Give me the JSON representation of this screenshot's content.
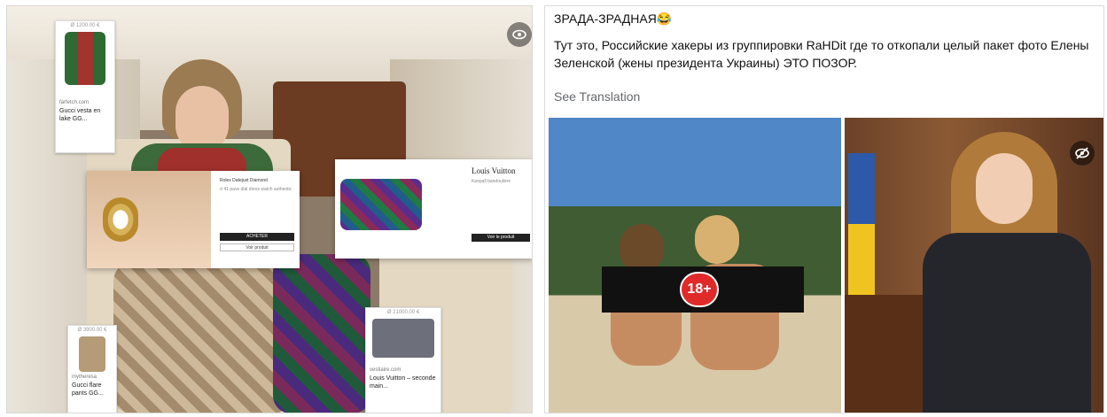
{
  "left_image": {
    "tags": [
      {
        "price": "Ø 1200.00 €",
        "site": "farfetch.com",
        "name": "Gucci vesta en lake GG..."
      },
      {
        "price": "Ø 3900.00 €",
        "site": "mytheresa",
        "name": "Gucci flare pants GG..."
      },
      {
        "price": "Ø 21000.00 €",
        "site": "vestiaire.com",
        "name": "Louis Vuitton – seconde main..."
      }
    ],
    "watch_modal": {
      "title": "Rolex Datejust Diamond",
      "desc": "rt 41 pave dial dress watch authentic",
      "btn_primary": "ACHETER",
      "btn_secondary": "Voir produit"
    },
    "bag_modal": {
      "title": "Louis Vuitton",
      "desc": "Keepall bandoulière",
      "btn_primary": "Voir le produit"
    },
    "eye_icon": "eye-icon"
  },
  "post": {
    "title": "ЗРАДА-ЗРАДНАЯ😂",
    "body": "Тут это, Российские хакеры из группировки RaHDit где то откопали целый пакет фото Елены Зеленской (жены президента Украины) ЭТО ПОЗОР.",
    "see_translation": "See Translation",
    "censor_badge": "18+",
    "hidden_icon": "eye-off-icon"
  }
}
